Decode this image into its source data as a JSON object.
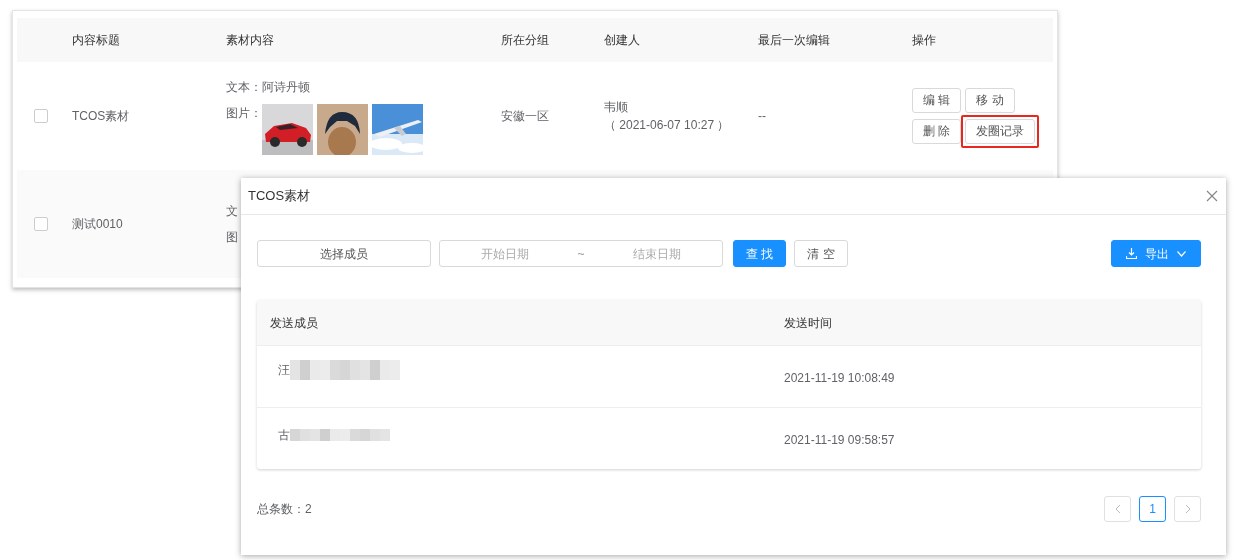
{
  "table": {
    "columns": [
      "内容标题",
      "素材内容",
      "所在分组",
      "创建人",
      "最后一次编辑",
      "操作"
    ],
    "rows": [
      {
        "checked": false,
        "title": "TCOS素材",
        "text_label": "文本：",
        "text": "阿诗丹顿",
        "images_label": "图片：",
        "group": "安徽一区",
        "creator": "韦顺",
        "created": "（ 2021-06-07 10:27 ）",
        "last_edit": "--",
        "actions": [
          {
            "label": "编 辑",
            "highlighted": false
          },
          {
            "label": "移 动",
            "highlighted": false
          },
          {
            "label": "删 除",
            "highlighted": false
          },
          {
            "label": "发圈记录",
            "highlighted": true
          }
        ]
      },
      {
        "checked": false,
        "title": "测试0010",
        "text_label": "文",
        "images_label": "图"
      }
    ]
  },
  "dialog": {
    "title": "TCOS素材",
    "filters": {
      "member_placeholder": "选择成员",
      "start_placeholder": "开始日期",
      "separator": "~",
      "end_placeholder": "结束日期"
    },
    "buttons": [
      {
        "label": "查 找",
        "kind": "primary"
      },
      {
        "label": "清 空",
        "kind": "default"
      }
    ],
    "export": {
      "label": "导出"
    },
    "columns": [
      "发送成员",
      "发送时间"
    ],
    "rows": [
      {
        "member": "汪",
        "time": "2021-11-19 10:08:49"
      },
      {
        "member": "古",
        "time": "2021-11-19 09:58:57"
      }
    ],
    "total": "总条数：2",
    "pages": [
      {
        "label": "1",
        "selected": true
      }
    ]
  }
}
